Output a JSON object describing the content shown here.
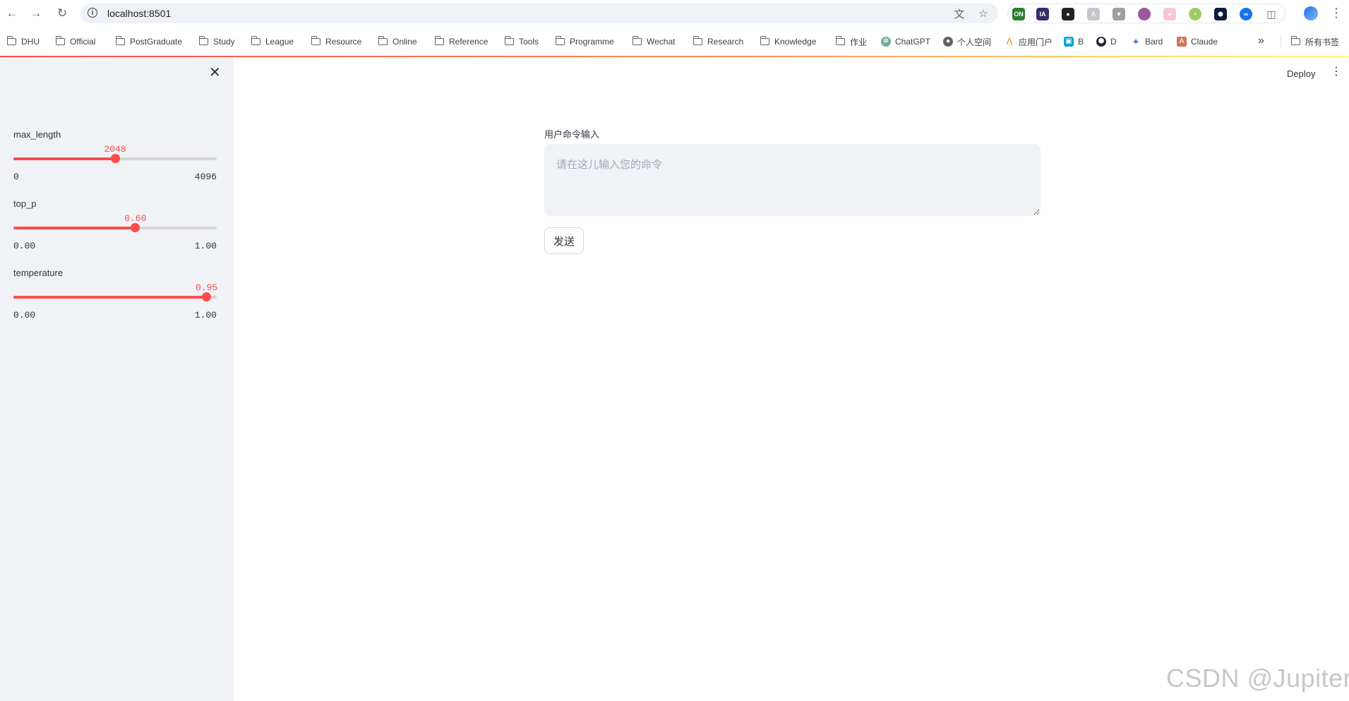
{
  "browser": {
    "url": "localhost:8501",
    "bookmarks": [
      {
        "label": "DHU",
        "icon": "folder-icon"
      },
      {
        "label": "Official",
        "icon": "folder-icon"
      },
      {
        "label": "PostGraduate",
        "icon": "folder-icon"
      },
      {
        "label": "Study",
        "icon": "folder-icon"
      },
      {
        "label": "League",
        "icon": "folder-icon"
      },
      {
        "label": "Resource",
        "icon": "folder-icon"
      },
      {
        "label": "Online",
        "icon": "folder-icon"
      },
      {
        "label": "Reference",
        "icon": "folder-icon"
      },
      {
        "label": "Tools",
        "icon": "folder-icon"
      },
      {
        "label": "Programme",
        "icon": "folder-icon"
      },
      {
        "label": "Wechat",
        "icon": "folder-icon"
      },
      {
        "label": "Research",
        "icon": "folder-icon"
      },
      {
        "label": "Knowledge",
        "icon": "folder-icon"
      },
      {
        "label": "作业",
        "icon": "folder-icon"
      },
      {
        "label": "ChatGPT",
        "icon": "chatgpt-icon"
      },
      {
        "label": "个人空间",
        "icon": "globe-icon"
      },
      {
        "label": "应用门户",
        "icon": "portal-icon"
      },
      {
        "label": "B",
        "icon": "bilibili-icon"
      },
      {
        "label": "D",
        "icon": "d-icon"
      },
      {
        "label": "Bard",
        "icon": "bard-icon"
      },
      {
        "label": "Claude",
        "icon": "claude-icon"
      }
    ],
    "all_bookmarks_label": "所有书签"
  },
  "sidebar": {
    "sliders": [
      {
        "name": "max-length",
        "label": "max_length",
        "value_text": "2048",
        "min_text": "0",
        "max_text": "4096",
        "fraction": 0.5
      },
      {
        "name": "top-p",
        "label": "top_p",
        "value_text": "0.60",
        "min_text": "0.00",
        "max_text": "1.00",
        "fraction": 0.6
      },
      {
        "name": "temperature",
        "label": "temperature",
        "value_text": "0.95",
        "min_text": "0.00",
        "max_text": "1.00",
        "fraction": 0.95
      }
    ]
  },
  "header": {
    "deploy_label": "Deploy"
  },
  "main": {
    "input_label": "用户命令输入",
    "input_placeholder": "请在这儿输入您的命令",
    "input_value": "",
    "send_label": "发送"
  },
  "watermark": "CSDN @Jupiter·",
  "colors": {
    "accent": "#ff4b4b",
    "sidebar_bg": "#f0f2f6",
    "text": "#31333f"
  }
}
